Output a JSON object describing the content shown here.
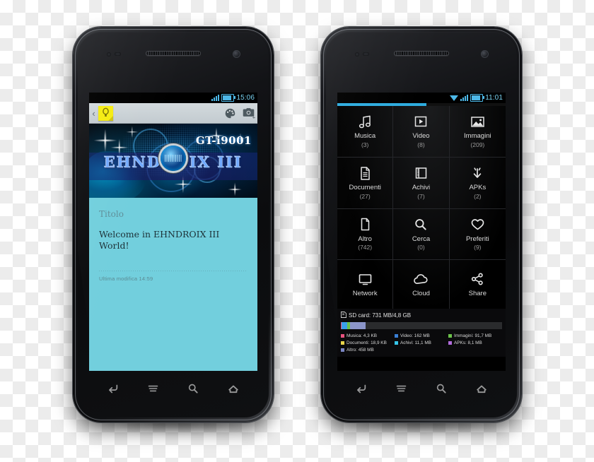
{
  "scene": {
    "background": "transparency-checkerboard",
    "device_count": 2
  },
  "left_phone": {
    "model_label": "GT-i9001",
    "status_bar": {
      "time": "15:06",
      "signal_icon": "signal-bars-icon",
      "battery_icon": "battery-icon"
    },
    "toolbar": {
      "back_glyph": "‹",
      "note_icon": "sticky-note-icon",
      "palette_icon": "palette-icon",
      "camera_icon": "camera-add-icon"
    },
    "banner": {
      "rom_name": "EHNDROIX III",
      "model": "GT-i9001"
    },
    "note": {
      "title": "Titolo",
      "body": "Welcome in EHNDROIX III World!",
      "meta": "Ultima modifica 14:59"
    },
    "nav": {
      "back": "back-icon",
      "menu": "menu-icon",
      "search": "search-icon",
      "home": "home-icon"
    }
  },
  "right_phone": {
    "status_bar": {
      "time": "11:01",
      "wifi_icon": "wifi-icon",
      "signal_icon": "signal-bars-icon",
      "battery_icon": "battery-icon"
    },
    "progress": {
      "percent": 53,
      "color": "#2eacdf"
    },
    "grid": [
      {
        "label": "Musica",
        "count": "(3)",
        "icon": "music-note-icon"
      },
      {
        "label": "Video",
        "count": "(8)",
        "icon": "play-video-icon"
      },
      {
        "label": "Immagini",
        "count": "(209)",
        "icon": "image-icon"
      },
      {
        "label": "Documenti",
        "count": "(27)",
        "icon": "document-icon"
      },
      {
        "label": "Achivi",
        "count": "(7)",
        "icon": "archive-icon"
      },
      {
        "label": "APKs",
        "count": "(2)",
        "icon": "download-apk-icon"
      },
      {
        "label": "Altro",
        "count": "(742)",
        "icon": "file-blank-icon"
      },
      {
        "label": "Cerca",
        "count": "(0)",
        "icon": "search-icon"
      },
      {
        "label": "Preferiti",
        "count": "(9)",
        "icon": "heart-icon"
      },
      {
        "label": "Network",
        "count": "",
        "icon": "monitor-icon"
      },
      {
        "label": "Cloud",
        "count": "",
        "icon": "cloud-icon"
      },
      {
        "label": "Share",
        "count": "",
        "icon": "share-icon"
      }
    ],
    "storage": {
      "header": "SD card: 731 MB/4,8 GB",
      "header_icon": "sdcard-icon",
      "used_percent": 21,
      "segments": [
        {
          "color": "#e8527f",
          "width": 0.6
        },
        {
          "color": "#3aa0ea",
          "width": 3.3
        },
        {
          "color": "#6cc24a",
          "width": 1.9
        },
        {
          "color": "#8b95c9",
          "width": 9.5
        }
      ],
      "legend": [
        {
          "label": "Musica: 4,3 KB",
          "color": "#e8527f"
        },
        {
          "label": "Video: 162 MB",
          "color": "#3a7fd5"
        },
        {
          "label": "Immagini: 91,7 MB",
          "color": "#6cc24a"
        },
        {
          "label": "Documenti: 18,9 KB",
          "color": "#e8d44a"
        },
        {
          "label": "Achivi: 11,1 MB",
          "color": "#35c4e8"
        },
        {
          "label": "APKs: 8,1 MB",
          "color": "#b26cdd"
        },
        {
          "label": "Altro: 458 MB",
          "color": "#7b86c4"
        }
      ]
    },
    "nav": {
      "back": "back-icon",
      "menu": "menu-icon",
      "search": "search-icon",
      "home": "home-icon"
    }
  }
}
